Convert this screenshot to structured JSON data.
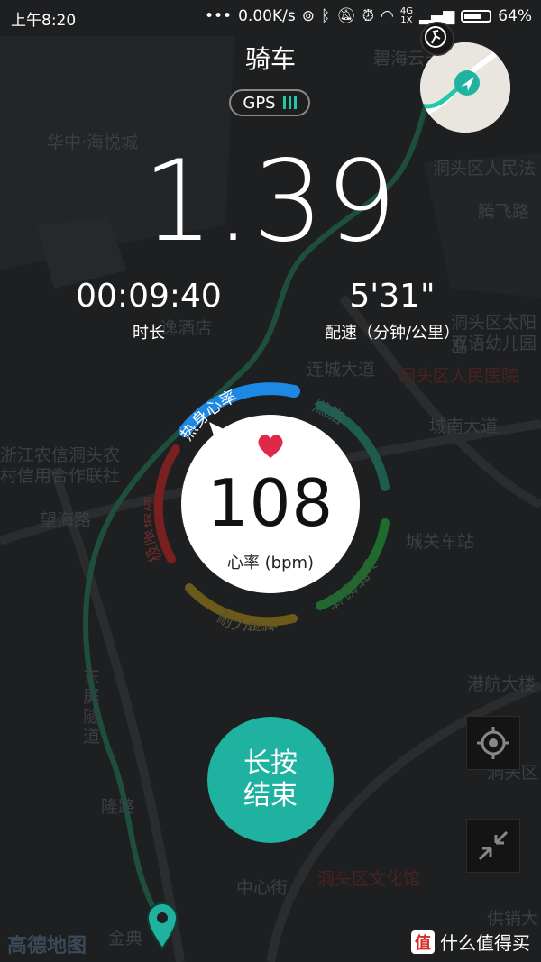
{
  "status": {
    "time": "上午8:20",
    "net_speed": "0.00K/s",
    "net_type_top": "4G",
    "net_type_bottom": "1X",
    "battery": "64%"
  },
  "title": "骑车",
  "gps": {
    "label": "GPS"
  },
  "distance": "1.39",
  "stats": [
    {
      "value": "00:09:40",
      "label": "时长"
    },
    {
      "value": "5'31\"",
      "label": "配速（分钟/公里）"
    }
  ],
  "heart": {
    "value": "108",
    "unit": "心率 (bpm)",
    "zones": [
      "热身心率",
      "燃脂",
      "心肺锻炼",
      "耐力锻炼",
      "极限锻炼"
    ],
    "active_zone": "热身心率",
    "zone_colors": {
      "warmup": "#1e88e5",
      "fatburn": "#1d5c4e",
      "cardio": "#1f6b2e",
      "endurance": "#6b5a1a",
      "extreme": "#7a2020"
    }
  },
  "end_button": {
    "line1": "长按",
    "line2": "结束"
  },
  "map": {
    "provider": "高德地图",
    "labels": [
      "碧海云天",
      "华中·海悦城",
      "洞头区人民法",
      "腾飞路",
      "洞头区太阳岛",
      "双语幼儿园",
      "洞头区人民医院",
      "城南大道",
      "浙江农信洞头农",
      "村信用合作联社",
      "城关车站",
      "港航大楼",
      "洞头区文化馆",
      "中心街",
      "供销大",
      "金典",
      "逸酒店",
      "连城大道",
      "望海路",
      "东屏隧道",
      "洞头区",
      "隆路"
    ]
  },
  "watermark": {
    "logo": "值",
    "text": "什么值得买"
  },
  "accent_color": "#1fb2a0"
}
